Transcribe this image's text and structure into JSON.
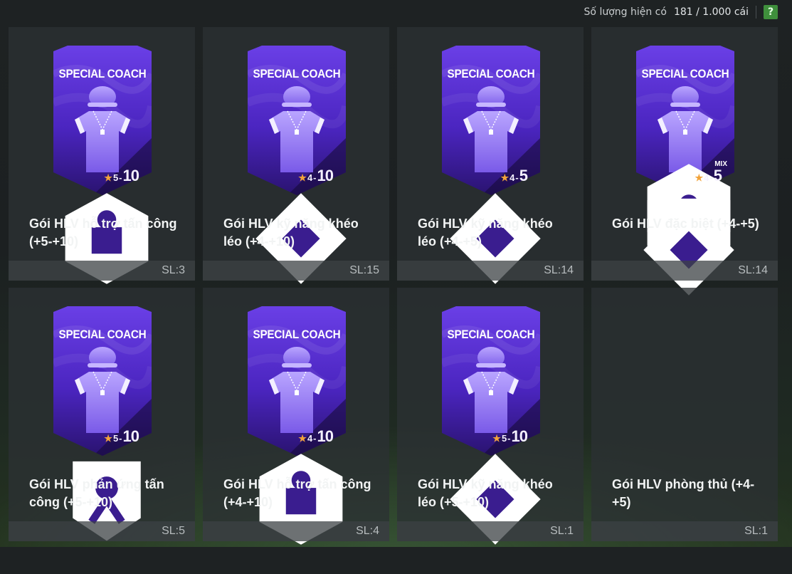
{
  "header": {
    "stock_label": "Số lượng hiện có",
    "stock_value": "181 / 1.000 cái",
    "help_label": "?"
  },
  "cards": [
    {
      "title": "SPECIAL COACH",
      "name": "Gói HLV hỗ trợ tấn công (+5-+10)",
      "grade_low": "5",
      "grade_high": "10",
      "qty": "SL:3",
      "badge_icon": "attack-support-icon"
    },
    {
      "title": "SPECIAL COACH",
      "name": "Gói HLV kỹ năng khéo léo (+4-+10)",
      "grade_low": "4",
      "grade_high": "10",
      "qty": "SL:15",
      "badge_icon": "skill-icon"
    },
    {
      "title": "SPECIAL COACH",
      "name": "Gói HLV kỹ năng khéo léo (+4-+5)",
      "grade_low": "4",
      "grade_high": "5",
      "qty": "SL:14",
      "badge_icon": "skill-icon"
    },
    {
      "title": "SPECIAL COACH",
      "name": "Gói HLV đặc biệt (+4-+5)",
      "grade_low": "4",
      "grade_high": "5",
      "qty": "SL:14",
      "badge_icon": "mixed-icons",
      "mix_label": "MIX"
    },
    {
      "title": "SPECIAL COACH",
      "name": "Gói HLV phản ứng tấn công (+5-+10)",
      "grade_low": "5",
      "grade_high": "10",
      "qty": "SL:5",
      "badge_icon": "counter-attack-icon"
    },
    {
      "title": "SPECIAL COACH",
      "name": "Gói HLV hỗ trợ tấn công (+4-+10)",
      "grade_low": "4",
      "grade_high": "10",
      "qty": "SL:4",
      "badge_icon": "attack-support-icon"
    },
    {
      "title": "SPECIAL COACH",
      "name": "Gói HLV kỹ năng khéo léo (+5-+10)",
      "grade_low": "5",
      "grade_high": "10",
      "qty": "SL:1",
      "badge_icon": "skill-icon"
    },
    {
      "title": "",
      "name": "Gói HLV phòng thủ (+4-+5)",
      "qty": "SL:1",
      "badge_icon": ""
    }
  ],
  "colors": {
    "card_purple_top": "#6a3fe6",
    "card_purple_bottom": "#2a1370",
    "star": "#f2a33a",
    "help_green": "#3f8f3c"
  }
}
